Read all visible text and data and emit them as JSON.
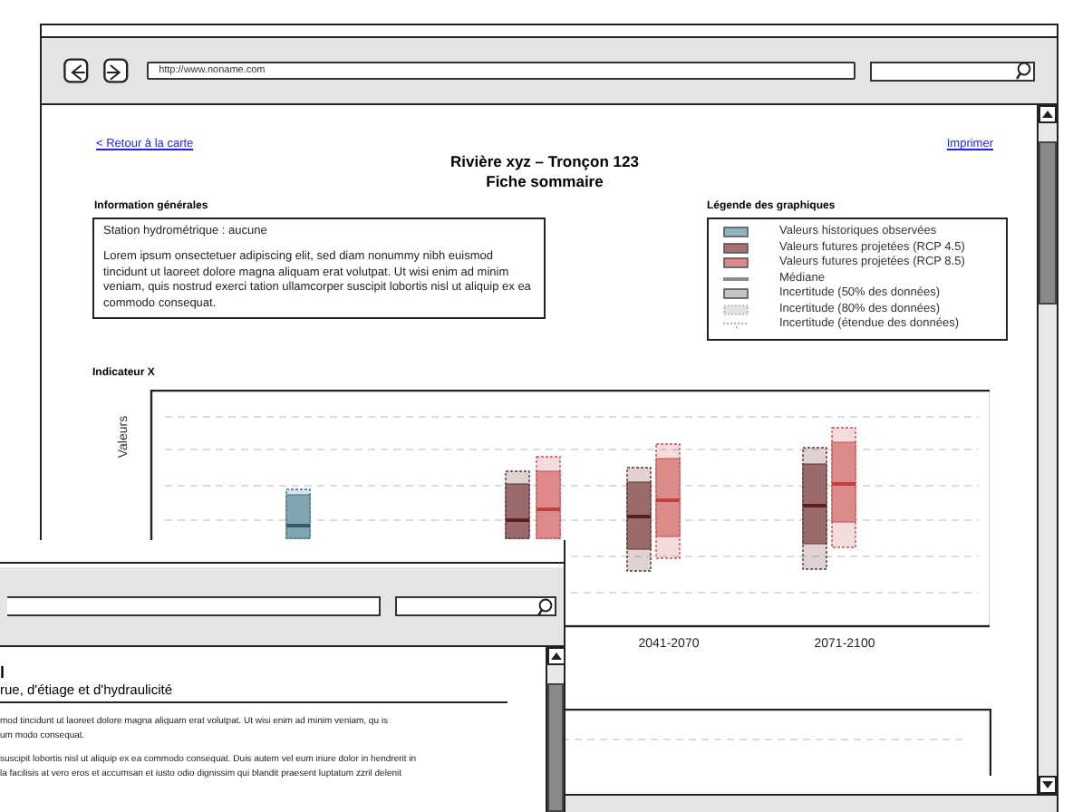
{
  "main_window": {
    "url": "http://www.noname.com",
    "back_link": "< Retour à la carte",
    "print_link": "Imprimer",
    "title": "Rivière xyz – Tronçon 123",
    "subtitle": "Fiche sommaire",
    "general_info": {
      "heading": "Information générales",
      "station": "Station hydrométrique : aucune",
      "description": "Lorem ipsum onsectetuer adipiscing elit, sed diam nonummy nibh euismod tincidunt ut laoreet dolore magna aliquam erat volutpat. Ut wisi enim ad minim veniam, quis nostrud exerci tation ullamcorper suscipit lobortis nisl ut aliquip ex ea commodo consequat."
    },
    "legend": {
      "heading": "Légende des graphiques",
      "items": [
        {
          "kind": "fill",
          "color": "#8fb4bd",
          "label": "Valeurs historiques observées"
        },
        {
          "kind": "fill",
          "color": "#a77272",
          "label": "Valeurs futures projetées (RCP 4.5)"
        },
        {
          "kind": "fill",
          "color": "#db8a8a",
          "label": "Valeurs futures projetées (RCP 8.5)"
        },
        {
          "kind": "line",
          "color": "#8a8a8a",
          "label": "Médiane"
        },
        {
          "kind": "fill",
          "color": "#c4c4c4",
          "label": "Incertitude (50% des données)"
        },
        {
          "kind": "dotted-box",
          "color": "#e2e2e2",
          "label": "Incertitude (80% des données)"
        },
        {
          "kind": "dotted-line",
          "color": "#b0b0b0",
          "label": "Incertitude (étendue des données)"
        }
      ]
    },
    "indicator": {
      "title": "Indicateur X",
      "ylabel": "Valeurs",
      "x_labels": [
        "2041-2070",
        "2071-2100"
      ]
    }
  },
  "front_window": {
    "heading": "l",
    "subtitle": "rue, d'étiage et d'hydraulicité",
    "paragraphs": [
      {
        "lines": [
          "mod tincidunt ut laoreet dolore magna aliquam erat volutpat. Ut wisi enim ad minim veniam, qu is",
          "um modo consequat."
        ]
      },
      {
        "lines": [
          "suscipit lobortis nisl ut aliquip ex ea commodo consequat. Duis autem vel eum iriure dolor in hendrerit in",
          "la facilisis at vero eros et accumsan et iusto odio dignissim qui blandit praesent luptatum zzril delenit"
        ]
      }
    ]
  }
}
